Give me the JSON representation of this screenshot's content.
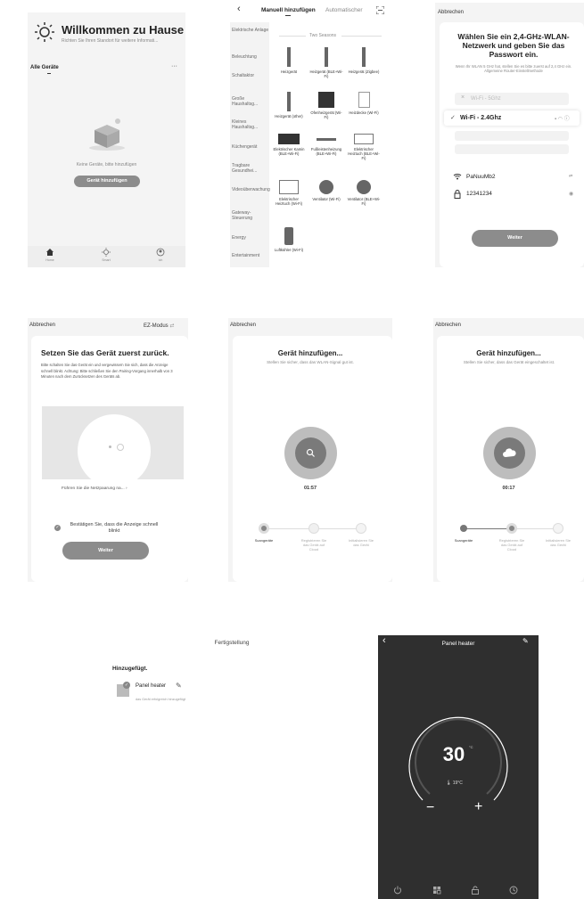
{
  "screen1": {
    "welcome_title": "Willkommen zu Hause",
    "location_hint": "Richten Sie Ihren Standort für weitere Informati...",
    "all_devices": "Alle Geräte",
    "more_dots": "···",
    "empty_text": "Keine Geräte, bitte hinzufügen",
    "add_device_button": "Gerät hinzufügen",
    "nav": [
      {
        "label": "Home",
        "icon": "home-icon"
      },
      {
        "label": "Smart",
        "icon": "sun-icon"
      },
      {
        "label": "Ich",
        "icon": "profile-icon"
      }
    ]
  },
  "screen2": {
    "back": "‹",
    "tab_manual": "Manuell hinzufügen",
    "tab_auto": "Automatischer",
    "scan_icon": "scan-icon",
    "section_title": "Two Seasons",
    "categories": [
      "Elektrische Anlage",
      "Beleuchtung",
      "Schaltaktor",
      "Große Haushaltsg...",
      "Kleines Haushaltsg...",
      "Küchengerät",
      "Tragbare Gesundhei...",
      "Videoüberwachung",
      "Gateway-Steuerung",
      "Energy",
      "Entertainment"
    ],
    "devices": [
      "Heizgerät",
      "Heizgerät (BLE+Wi-Fi)",
      "Heizgerät (Zigbee)",
      "Heizgerät (other)",
      "Ofenheizgerät (Wi-Fi)",
      "Heizdecke (Wi-Fi)",
      "Elektrischer Kamin (BLE+Wi-Fi)",
      "Fußleistenheizung (BLE+Wi-Fi)",
      "Elektrischer Heiztuch (BLE+Wi-Fi)",
      "Elektrischer Heiztuch (Wi-Fi)",
      "Ventilator (Wi-Fi)",
      "Ventilator (BLE+Wi-Fi)",
      "Luftkühler (Wi-Fi)"
    ]
  },
  "screen3": {
    "cancel": "Abbrechen",
    "title": "Wählen Sie ein 2,4-GHz-WLAN-Netzwerk und geben Sie das Passwort ein.",
    "hint": "Wenn Ihr WLAN 5 GHz hat, stellen Sie es bitte zuerst auf 2,4 GHz ein. Allgemeine Router-Einstellmethode",
    "wifi_5": "Wi-Fi - 5Ghz",
    "wifi_24": "Wi-Fi - 2.4Ghz",
    "ssid": "PaNuuMb2",
    "password": "12341234",
    "next_button": "Weiter"
  },
  "screen4": {
    "cancel": "Abbrechen",
    "mode": "EZ-Modus",
    "title": "Setzen Sie das Gerät zuerst zurück.",
    "body": "Bitte schalten Sie das Gerät ein und vergewissern Sie sich, dass die Anzeige schnell blinkt. Achtung: Bitte schließen Sie den Pairing-Vorgang innerhalb von 3 Minuten nach dem Zurücksetzen des Geräts ab.",
    "guide_link": "Führen Sie die Netzpaarung na...",
    "confirm_text": "Bestätigen Sie, dass die Anzeige schnell blinkt",
    "next_button": "Weiter"
  },
  "screen5": {
    "cancel": "Abbrechen",
    "title": "Gerät hinzufügen...",
    "subtitle": "Stellen Sie sicher, dass das WLAN-Signal gut ist.",
    "timer": "01:57",
    "steps": [
      "Scangeräte",
      "Registrieren Sie das Gerät auf Cloud",
      "Initialisieren Sie das Gerät"
    ]
  },
  "screen6": {
    "cancel": "Abbrechen",
    "title": "Gerät hinzufügen...",
    "subtitle": "Stellen Sie sicher, dass das Gerät eingeschaltet ist.",
    "timer": "00:17",
    "steps": [
      "Scangeräte",
      "Registrieren Sie das Gerät auf Cloud",
      "Initialisieren Sie das Gerät"
    ]
  },
  "screen7": {
    "header": "Fertigstellung",
    "added": "Hinzugefügt.",
    "device_name": "Panel heater",
    "device_status": "das Gerät erfolgreich hinzugefügt"
  },
  "screen8": {
    "back": "‹",
    "title": "Panel heater",
    "setpoint": "30",
    "unit": "°C",
    "current_temp": "19°C",
    "minus": "−",
    "plus": "+",
    "bottom_icons": [
      "power-icon",
      "mode-icon",
      "lock-icon",
      "timer-icon"
    ]
  },
  "colors": {
    "gray_button": "#8c8c8c",
    "dark_bg": "#2f2f2f"
  }
}
